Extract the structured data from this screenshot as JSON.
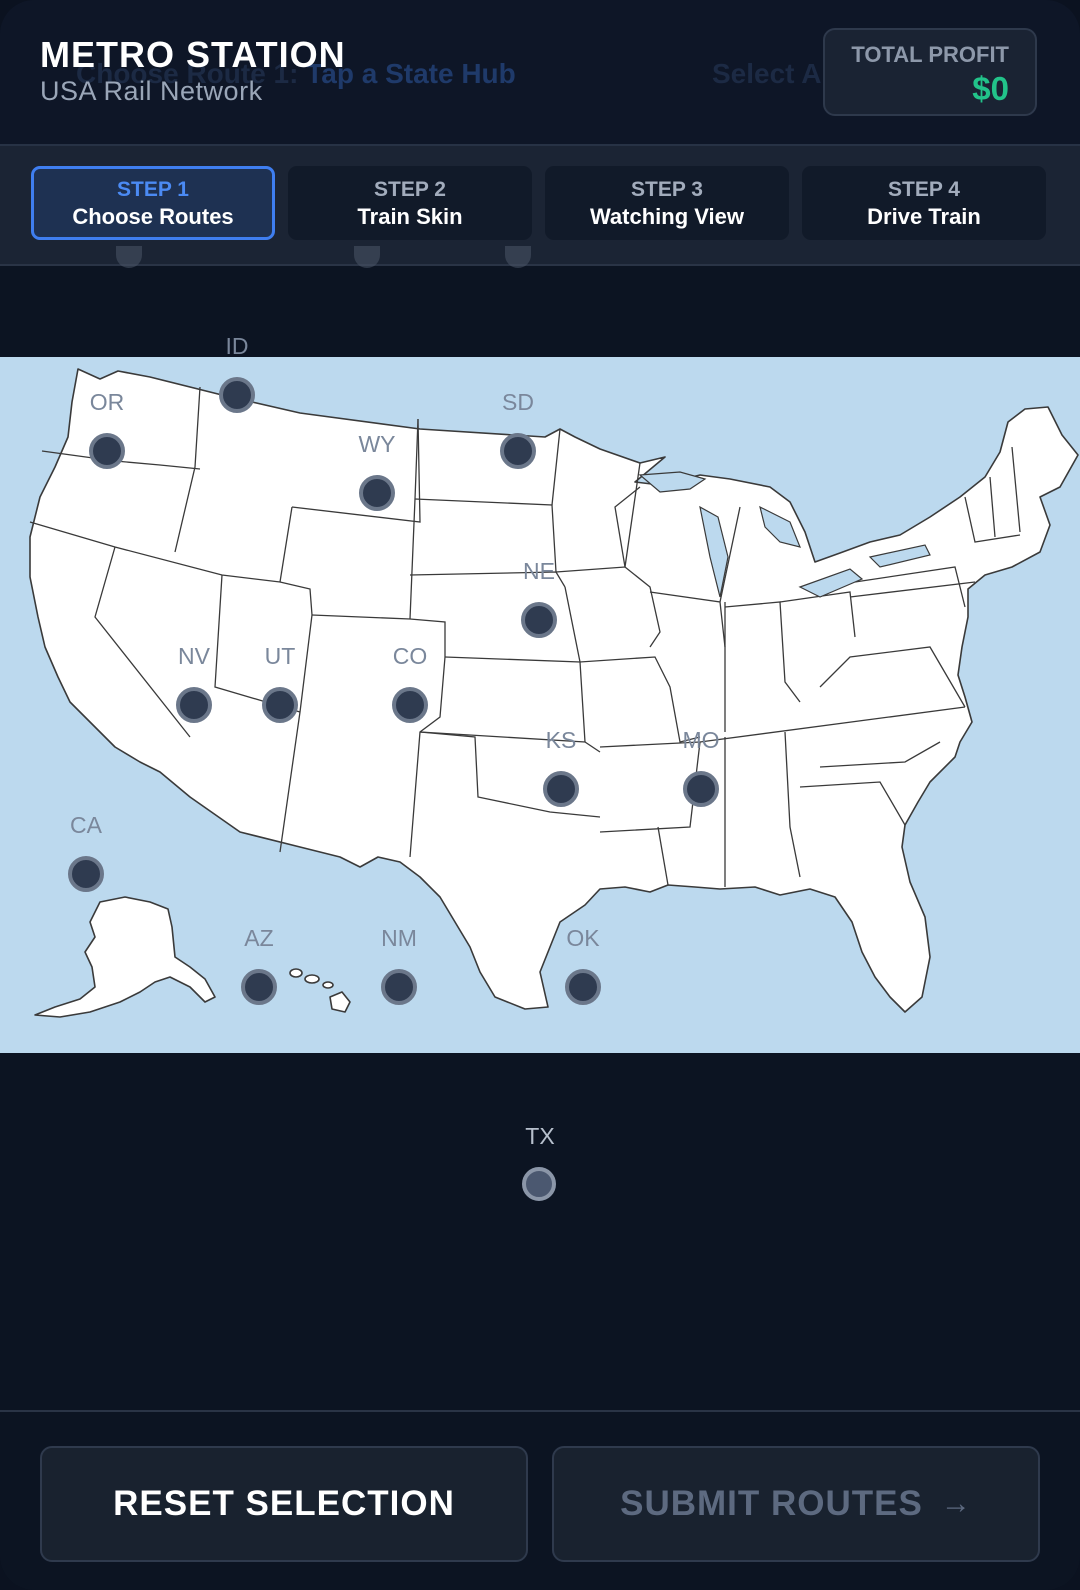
{
  "header": {
    "title": "METRO STATION",
    "subtitle": "USA Rail Network",
    "ghost_text": {
      "prefix": "Choose Route 1:",
      "highlight": "Tap a State Hub",
      "right": "Select A"
    },
    "profit_label": "TOTAL PROFIT",
    "profit_value": "$0"
  },
  "steps": [
    {
      "num": "STEP 1",
      "name": "Choose Routes",
      "active": true
    },
    {
      "num": "STEP 2",
      "name": "Train Skin",
      "active": false
    },
    {
      "num": "STEP 3",
      "name": "Watching View",
      "active": false
    },
    {
      "num": "STEP 4",
      "name": "Drive Train",
      "active": false
    }
  ],
  "hubs": [
    {
      "code": "ID"
    },
    {
      "code": "OR"
    },
    {
      "code": "SD"
    },
    {
      "code": "WY"
    },
    {
      "code": "NE"
    },
    {
      "code": "NV"
    },
    {
      "code": "UT"
    },
    {
      "code": "CO"
    },
    {
      "code": "KS"
    },
    {
      "code": "MO"
    },
    {
      "code": "CA"
    },
    {
      "code": "AZ"
    },
    {
      "code": "NM"
    },
    {
      "code": "OK"
    },
    {
      "code": "TX"
    }
  ],
  "colors": {
    "accent": "#3f7ef0",
    "profit": "#22c38a",
    "ocean": "#bcd9ee",
    "land": "#ffffff"
  },
  "footer": {
    "reset_label": "RESET SELECTION",
    "submit_label": "SUBMIT ROUTES",
    "submit_arrow": "→"
  }
}
